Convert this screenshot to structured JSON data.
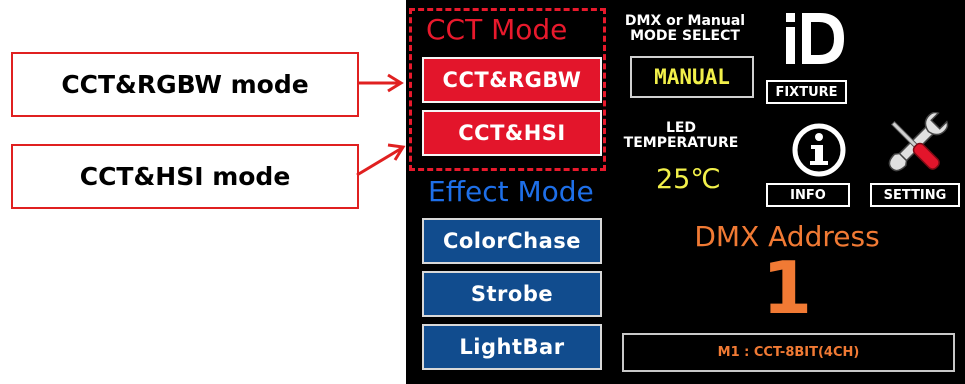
{
  "callouts": {
    "rgbw": "CCT&RGBW mode",
    "hsi": "CCT&HSI mode"
  },
  "cct_section": {
    "title": "CCT Mode",
    "buttons": [
      "CCT&RGBW",
      "CCT&HSI"
    ]
  },
  "effect_section": {
    "title": "Effect Mode",
    "buttons": [
      "ColorChase",
      "Strobe",
      "LightBar"
    ]
  },
  "mode_select": {
    "label_line1": "DMX or Manual",
    "label_line2": "MODE SELECT",
    "value": "MANUAL"
  },
  "led_temperature": {
    "label_line1": "LED",
    "label_line2": "TEMPERATURE",
    "value": "25℃"
  },
  "tiles": {
    "fixture": "FIXTURE",
    "info": "INFO",
    "setting": "SETTING"
  },
  "dmx_address": {
    "title": "DMX Address",
    "value": "1"
  },
  "status": "M1 : CCT-8BIT(4CH)",
  "colors": {
    "cct_red": "#e3152b",
    "effect_blue": "#114c8e",
    "effect_title_blue": "#1e6fe8",
    "yellow": "#f2f04a",
    "orange": "#f17a34",
    "callout_border": "#e02020"
  },
  "icons": [
    "id-icon",
    "info-icon",
    "wrench-screwdriver-icon",
    "arrow-right-icon"
  ]
}
